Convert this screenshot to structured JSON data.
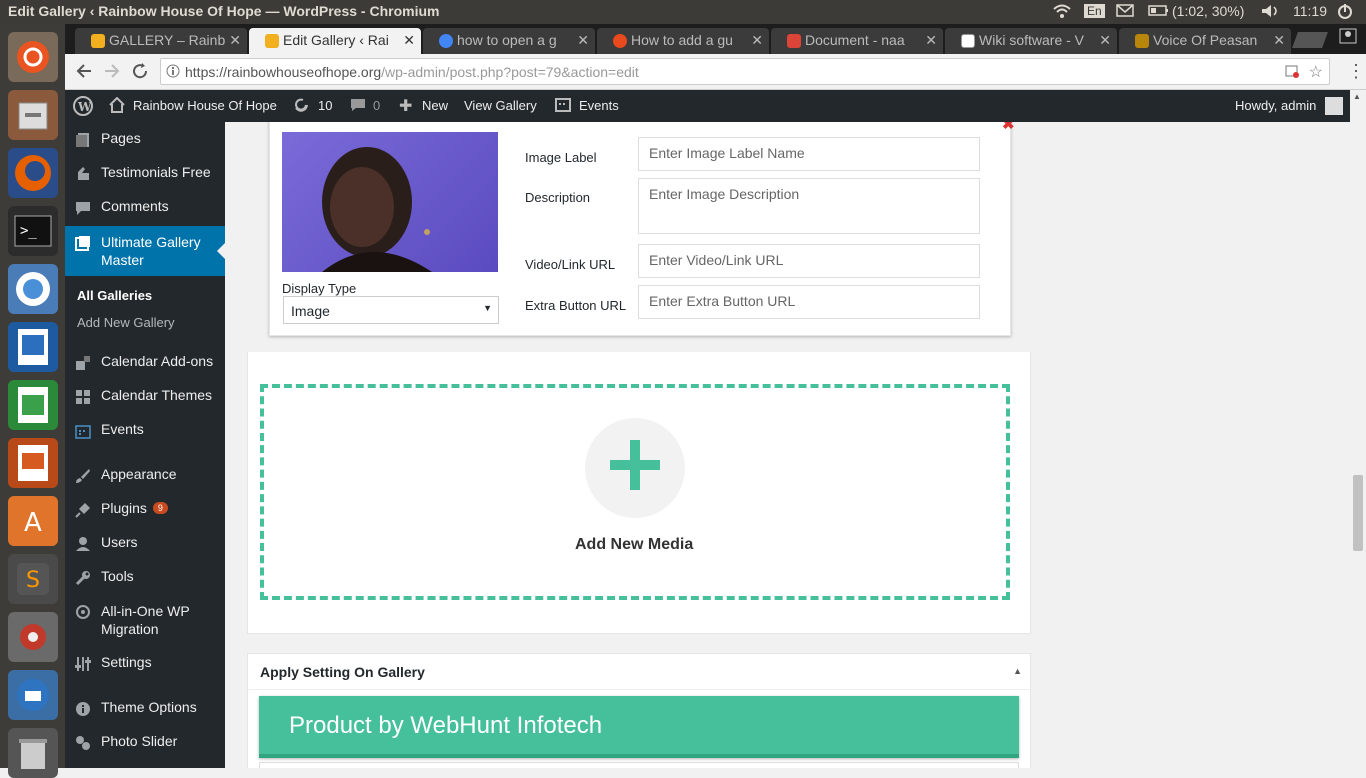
{
  "window": {
    "title": "Edit Gallery ‹ Rainbow House Of Hope — WordPress - Chromium"
  },
  "system": {
    "lang": "En",
    "battery": "(1:02, 30%)",
    "time": "11:19"
  },
  "tabs": [
    {
      "label": "GALLERY – Rainb"
    },
    {
      "label": "Edit Gallery ‹ Rai"
    },
    {
      "label": "how to open a g"
    },
    {
      "label": "How to add a gu"
    },
    {
      "label": "Document - naa"
    },
    {
      "label": "Wiki software - V"
    },
    {
      "label": "Voice Of Peasan"
    }
  ],
  "url": {
    "host": "https://rainbowhouseofhope.org",
    "path": "/wp-admin/post.php?post=79&action=edit"
  },
  "adminbar": {
    "site": "Rainbow House Of Hope",
    "updates": "10",
    "comments": "0",
    "new": "New",
    "view": "View Gallery",
    "events": "Events",
    "howdy": "Howdy, admin"
  },
  "menu": {
    "pages": "Pages",
    "testimonials": "Testimonials Free",
    "comments": "Comments",
    "ugm": "Ultimate Gallery Master",
    "all_galleries": "All Galleries",
    "add_new_gallery": "Add New Gallery",
    "cal_addons": "Calendar Add-ons",
    "cal_themes": "Calendar Themes",
    "events": "Events",
    "appearance": "Appearance",
    "plugins": "Plugins",
    "plugins_badge": "9",
    "users": "Users",
    "tools": "Tools",
    "aio": "All-in-One WP Migration",
    "settings": "Settings",
    "theme_options": "Theme Options",
    "photo_slider": "Photo Slider"
  },
  "item": {
    "display_type_label": "Display Type",
    "display_type_value": "Image",
    "image_label": "Image Label",
    "image_label_ph": "Enter Image Label Name",
    "description": "Description",
    "description_ph": "Enter Image Description",
    "video_url": "Video/Link URL",
    "video_url_ph": "Enter Video/Link URL",
    "extra_url": "Extra Button URL",
    "extra_url_ph": "Enter Extra Button URL"
  },
  "add_media": "Add New Media",
  "settings_box": {
    "title": "Apply Setting On Gallery",
    "banner": "Product by WebHunt Infotech"
  },
  "colors": {
    "accent": "#46c09a",
    "wp_blue": "#0073aa",
    "dark": "#23282d"
  }
}
